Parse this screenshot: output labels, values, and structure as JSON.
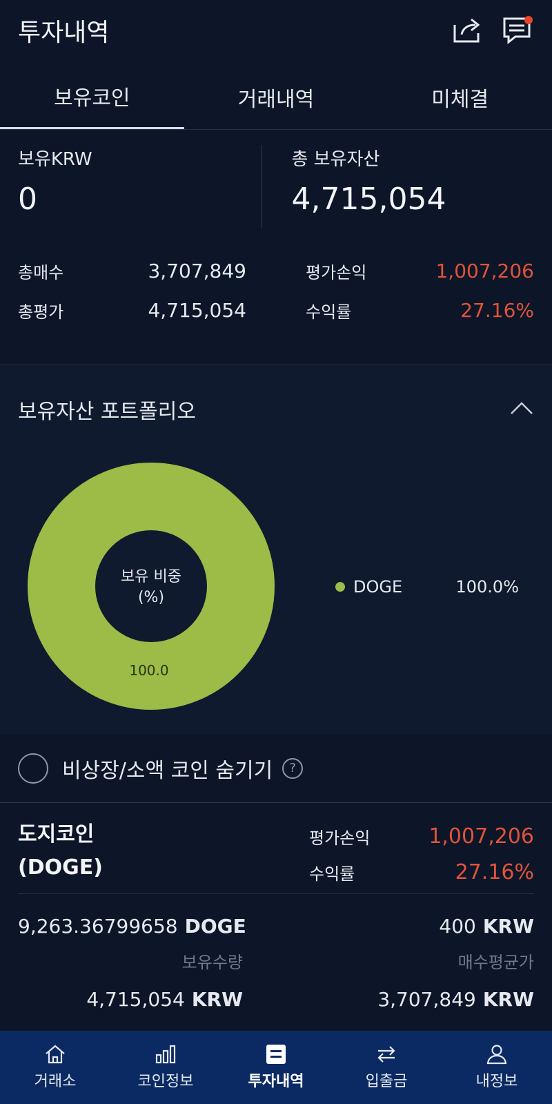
{
  "header": {
    "title": "투자내역",
    "share_icon": "share-icon",
    "chat_icon": "chat-icon"
  },
  "tabs": [
    {
      "label": "보유코인",
      "active": true
    },
    {
      "label": "거래내역",
      "active": false
    },
    {
      "label": "미체결",
      "active": false
    }
  ],
  "summary": {
    "krw_label": "보유KRW",
    "krw_value": "0",
    "total_label": "총 보유자산",
    "total_value": "4,715,054",
    "buy_label": "총매수",
    "buy_value": "3,707,849",
    "eval_label": "총평가",
    "eval_value": "4,715,054",
    "pl_label": "평가손익",
    "pl_value": "1,007,206",
    "rate_label": "수익률",
    "rate_value": "27.16%"
  },
  "portfolio": {
    "title": "보유자산 포트폴리오",
    "center_line1": "보유 비중",
    "center_line2": "(%)",
    "chart_data": {
      "type": "pie",
      "categories": [
        "DOGE"
      ],
      "values": [
        100.0
      ],
      "data_labels": [
        "100.0"
      ]
    },
    "legend": [
      {
        "name": "DOGE",
        "value": "100.0%"
      }
    ],
    "accent": "#9dbb47"
  },
  "filter": {
    "label": "비상장/소액 코인 숨기기",
    "help": "?"
  },
  "coin": {
    "name_line1": "도지코인",
    "name_line2": "(DOGE)",
    "pl_label": "평가손익",
    "pl_value": "1,007,206",
    "rate_label": "수익률",
    "rate_value": "27.16%",
    "qty_value": "9,263.36799658",
    "qty_unit": "DOGE",
    "qty_label": "보유수량",
    "avg_value": "400",
    "avg_unit": "KRW",
    "avg_label": "매수평균가",
    "eval_value": "4,715,054",
    "eval_unit": "KRW",
    "buy_value": "3,707,849",
    "buy_unit": "KRW"
  },
  "bottom_nav": [
    {
      "label": "거래소",
      "icon": "home-icon"
    },
    {
      "label": "코인정보",
      "icon": "bar-chart-icon"
    },
    {
      "label": "투자내역",
      "icon": "list-icon",
      "active": true
    },
    {
      "label": "입출금",
      "icon": "transfer-icon"
    },
    {
      "label": "내정보",
      "icon": "user-icon"
    }
  ],
  "colors": {
    "background": "#0d1628",
    "loss_profit_red": "#e0533a",
    "nav_bg": "#0b2a63"
  }
}
